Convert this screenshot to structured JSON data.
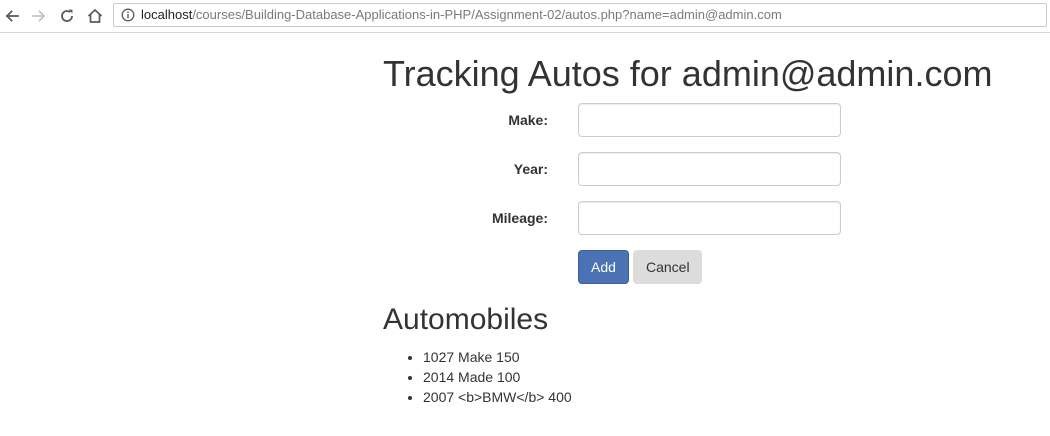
{
  "browser": {
    "url_host": "localhost",
    "url_path": "/courses/Building-Database-Applications-in-PHP/Assignment-02/autos.php?name=admin@admin.com"
  },
  "page": {
    "title": "Tracking Autos for admin@admin.com"
  },
  "form": {
    "make": {
      "label": "Make:",
      "value": "",
      "placeholder": ""
    },
    "year": {
      "label": "Year:",
      "value": "",
      "placeholder": ""
    },
    "mileage": {
      "label": "Mileage:",
      "value": "",
      "placeholder": ""
    },
    "add_label": "Add",
    "cancel_label": "Cancel"
  },
  "automobiles": {
    "heading": "Automobiles",
    "items": [
      "1027 Make 150",
      "2014 Made 100",
      "2007 <b>BMW</b> 400"
    ]
  },
  "colors": {
    "primary_button": "#4a72b5",
    "secondary_button": "#dcdcdc",
    "text": "#333333"
  },
  "icons": {
    "back": "back-arrow-icon",
    "forward": "forward-arrow-icon",
    "reload": "reload-icon",
    "home": "home-icon",
    "info": "info-icon"
  }
}
